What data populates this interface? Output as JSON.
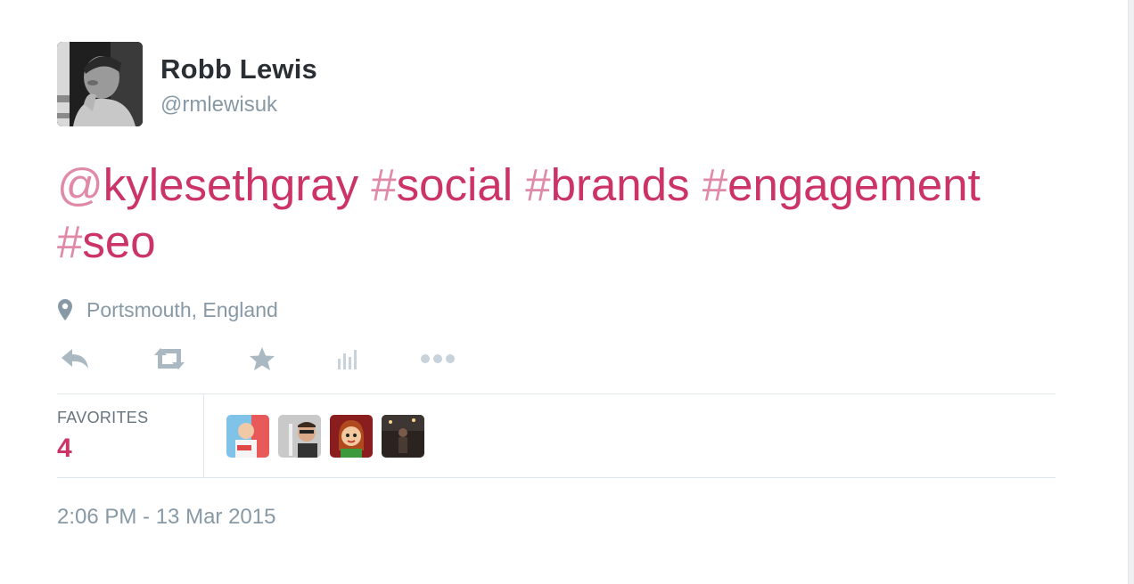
{
  "user": {
    "name": "Robb Lewis",
    "handle": "@rmlewisuk"
  },
  "tweet": {
    "tokens": [
      {
        "text": "@kylesethgray",
        "type": "mention"
      },
      {
        "text": " ",
        "type": "space"
      },
      {
        "text": "#social",
        "type": "hashtag"
      },
      {
        "text": " ",
        "type": "space"
      },
      {
        "text": "#brands",
        "type": "hashtag"
      },
      {
        "text": " ",
        "type": "space"
      },
      {
        "text": "#engagement",
        "type": "hashtag"
      },
      {
        "text": " ",
        "type": "space"
      },
      {
        "text": "#seo",
        "type": "hashtag"
      }
    ]
  },
  "location": {
    "text": "Portsmouth, England",
    "icon": "map-pin-icon"
  },
  "actions": [
    {
      "name": "reply",
      "icon": "reply-icon"
    },
    {
      "name": "retweet",
      "icon": "retweet-icon"
    },
    {
      "name": "favorite",
      "icon": "star-icon"
    },
    {
      "name": "analytics",
      "icon": "bar-chart-icon"
    },
    {
      "name": "more",
      "icon": "more-dots-icon"
    }
  ],
  "stats": {
    "label": "FAVORITES",
    "count": "4"
  },
  "favoriters": [
    {
      "name": "favoriter-1"
    },
    {
      "name": "favoriter-2"
    },
    {
      "name": "favoriter-3"
    },
    {
      "name": "favoriter-4"
    }
  ],
  "timestamp": "2:06 PM - 13 Mar 2015",
  "colors": {
    "link": "#cc3366",
    "name": "#292f33",
    "muted": "#8899a6",
    "icon": "#aab8c2",
    "divider": "#e1e8ed"
  }
}
